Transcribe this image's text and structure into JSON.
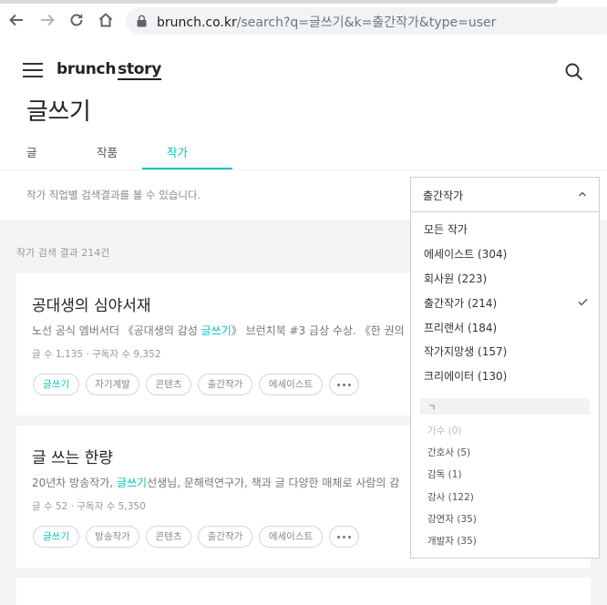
{
  "browser": {
    "url_host": "brunch.co.kr",
    "url_path": "/search?q=글쓰기&k=출간작가&type=user"
  },
  "header": {
    "logo_brunch": "brunch",
    "logo_story": "story",
    "page_title": "글쓰기"
  },
  "tabs": [
    {
      "label": "글",
      "active": false
    },
    {
      "label": "작품",
      "active": false
    },
    {
      "label": "작가",
      "active": true
    }
  ],
  "notice": "작가 직업별 검색결과를 볼 수 있습니다.",
  "result_count": "작가 검색 결과 214건",
  "cards": [
    {
      "title": "공대생의 심야서재",
      "desc_prefix": "노선 공식 엠버서더 《공대생의 감성 ",
      "desc_highlight": "글쓰기",
      "desc_suffix": "》 브런치북 #3 금상 수상. 《한 권의",
      "meta": "글 수 1,135 · 구독자 수 9,352",
      "tags": [
        "글쓰기",
        "자기계발",
        "콘텐츠",
        "출간작가",
        "에세이스트"
      ]
    },
    {
      "title": "글 쓰는 한량",
      "desc_prefix": "20년차 방송작가, ",
      "desc_highlight": "글쓰기",
      "desc_suffix": "선생님, 문해력연구가, 책과 글 다양한 매체로 사람의 감",
      "meta": "글 수 52 · 구독자 수 5,350",
      "tags": [
        "글쓰기",
        "방송작가",
        "콘텐츠",
        "출간작가",
        "에세이스트"
      ]
    }
  ],
  "dropdown": {
    "selected": "출간작가",
    "items": [
      {
        "label": "모든 작가",
        "checked": false
      },
      {
        "label": "에세이스트 (304)",
        "checked": false
      },
      {
        "label": "회사원 (223)",
        "checked": false
      },
      {
        "label": "출간작가 (214)",
        "checked": true
      },
      {
        "label": "프리랜서 (184)",
        "checked": false
      },
      {
        "label": "작가지망생 (157)",
        "checked": false
      },
      {
        "label": "크리에이터 (130)",
        "checked": false
      }
    ],
    "group_header": "ㄱ",
    "sub_items": [
      {
        "label": "가수 (0)",
        "disabled": true
      },
      {
        "label": "간호사 (5)",
        "disabled": false
      },
      {
        "label": "감독 (1)",
        "disabled": false
      },
      {
        "label": "강사 (122)",
        "disabled": false
      },
      {
        "label": "강연자 (35)",
        "disabled": false
      },
      {
        "label": "개발자 (35)",
        "disabled": false
      }
    ]
  },
  "colors": {
    "accent": "#00c3bd"
  }
}
